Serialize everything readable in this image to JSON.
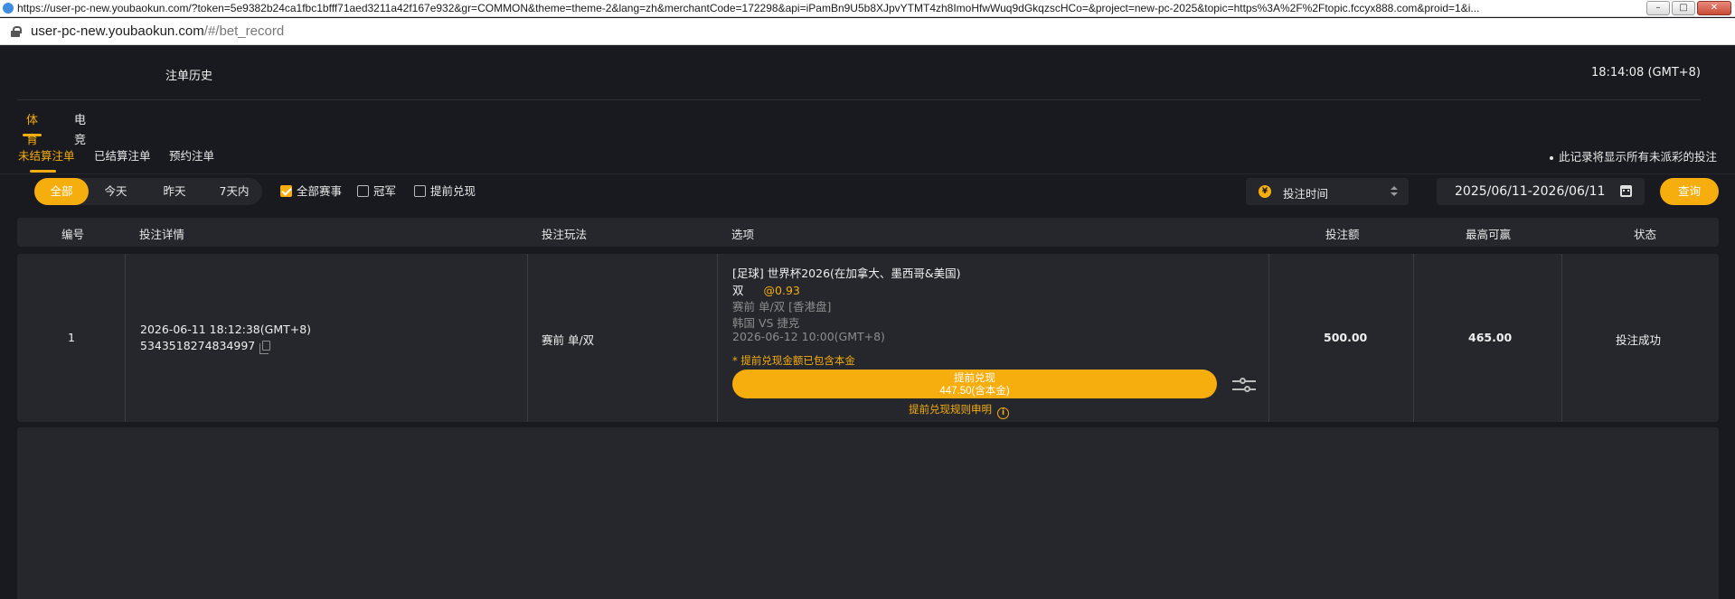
{
  "browser": {
    "full_url": "https://user-pc-new.youbaokun.com/?token=5e9382b24ca1fbc1bfff71aed3211a42f167e932&gr=COMMON&theme=theme-2&lang=zh&merchantCode=172298&api=iPamBn9U5b8XJpvYTMT4zh8ImoHfwWuq9dGkqzscHCo=&project=new-pc-2025&topic=https%3A%2F%2Ftopic.fccyx888.com&proid=1&i...",
    "url_host": "user-pc-new.youbaokun.com",
    "url_path": "/#/bet_record",
    "min_label": "–",
    "max_label": "□",
    "close_label": "✕"
  },
  "header": {
    "title": "注单历史",
    "time": "18:14:08 (GMT+8)"
  },
  "tabs": [
    {
      "label": "体育",
      "active": true
    },
    {
      "label": "电竞",
      "active": false
    }
  ],
  "subtabs": [
    {
      "label": "未结算注单",
      "active": true
    },
    {
      "label": "已结算注单",
      "active": false
    },
    {
      "label": "预约注单",
      "active": false
    }
  ],
  "notice": "此记录将显示所有未派彩的投注",
  "filters": {
    "date_segments": [
      {
        "label": "全部",
        "active": true
      },
      {
        "label": "今天",
        "active": false
      },
      {
        "label": "昨天",
        "active": false
      },
      {
        "label": "7天内",
        "active": false
      }
    ],
    "checkboxes": [
      {
        "label": "全部赛事",
        "checked": true
      },
      {
        "label": "冠军",
        "checked": false
      },
      {
        "label": "提前兑现",
        "checked": false
      }
    ],
    "sort_label": "投注时间",
    "sort_icon_text": "¥",
    "date_range": "2025/06/11-2026/06/11",
    "query_label": "查询"
  },
  "table": {
    "headers": [
      "编号",
      "投注详情",
      "投注玩法",
      "选项",
      "投注额",
      "最高可赢",
      "状态"
    ],
    "rows": [
      {
        "index": "1",
        "bet_time": "2026-06-11 18:12:38(GMT+8)",
        "bet_id": "5343518274834997",
        "play_type": "赛前  单/双",
        "league": "[足球] 世界杯2026(在加拿大、墨西哥&美国)",
        "selection": "双",
        "odds": "@0.93",
        "market": "赛前 单/双 [香港盘]",
        "teams": "韩国 VS 捷克",
        "match_time": "2026-06-12 10:00(GMT+8)",
        "cashout_note": "* 提前兑现金额已包含本金",
        "cashout_title": "提前兑现",
        "cashout_amount": "447.50(含本金)",
        "cashout_rules": "提前兑现规则申明",
        "stake": "500.00",
        "max_win": "465.00",
        "status": "投注成功"
      }
    ]
  },
  "colors": {
    "accent": "#f6ad0e",
    "background": "#191a1f",
    "panel": "#25272d"
  }
}
